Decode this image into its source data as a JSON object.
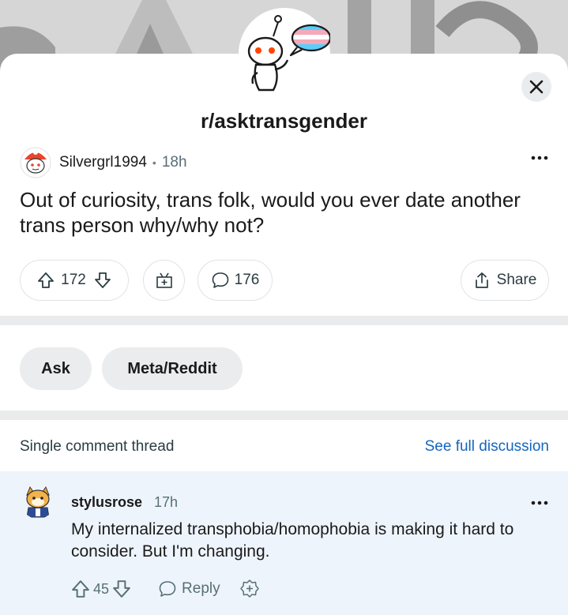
{
  "subreddit": {
    "name": "r/asktransgender"
  },
  "post": {
    "author": "Silvergrl1994",
    "separator": "•",
    "age": "18h",
    "title": "Out of curiosity, trans folk, would you ever date another trans person why/why not?",
    "upvotes": "172",
    "comments": "176",
    "share_label": "Share"
  },
  "flairs": [
    "Ask",
    "Meta/Reddit"
  ],
  "thread": {
    "label": "Single comment thread",
    "see_full": "See full discussion"
  },
  "comment": {
    "author": "stylusrose",
    "age": "17h",
    "body": "My internalized transphobia/homophobia is making it hard to consider. But I'm changing.",
    "upvotes": "45",
    "reply_label": "Reply"
  },
  "colors": {
    "accent_link": "#1565c0",
    "snoo_red": "#ff4500",
    "flag_blue": "#5bcefa",
    "flag_pink": "#f5a9b8",
    "divider": "#e9ebec",
    "comment_bg": "#eef4fb"
  },
  "icons": [
    "close-icon",
    "more-icon",
    "upvote-icon",
    "downvote-icon",
    "award-icon",
    "comment-icon",
    "share-icon"
  ]
}
